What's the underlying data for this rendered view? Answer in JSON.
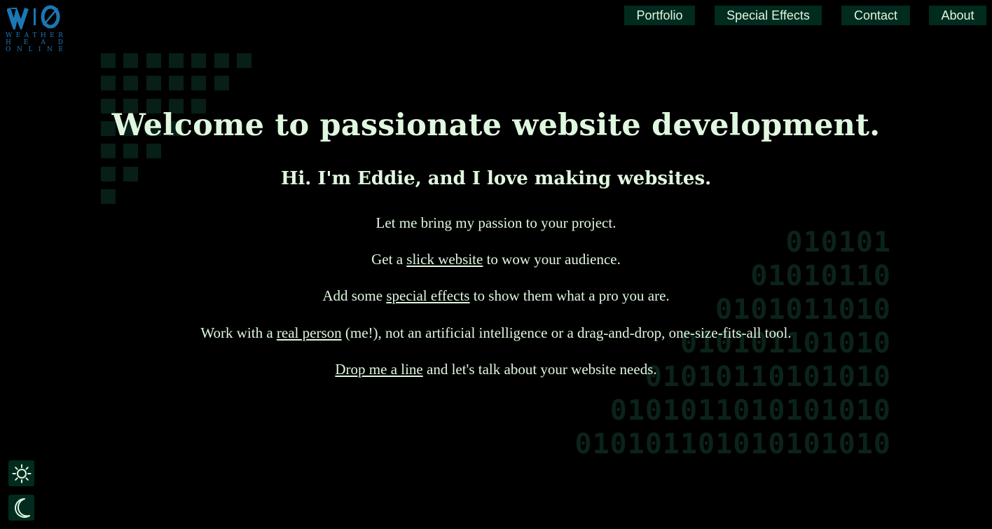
{
  "logo": {
    "mark": "WO",
    "lines": [
      "WEATHER",
      "HEAD",
      "ONLINE"
    ]
  },
  "nav": {
    "items": [
      "Portfolio",
      "Special Effects",
      "Contact",
      "About"
    ]
  },
  "background": {
    "binary_lines": [
      "010101",
      "01010110",
      "0101011010",
      "010101101010",
      "01010110101010",
      "0101011010101010",
      "010101101010101010"
    ]
  },
  "hero": {
    "title": "Welcome to passionate website development.",
    "subtitle": "Hi. I'm Eddie, and I love making websites."
  },
  "paragraphs": {
    "p1": "Let me bring my passion to your project.",
    "p2_before": "Get a ",
    "p2_link": "slick website",
    "p2_after": " to wow your audience.",
    "p3_before": "Add some ",
    "p3_link": "special effects",
    "p3_after": " to show them what a pro you are.",
    "p4_before": "Work with a ",
    "p4_link": "real person",
    "p4_after": " (me!), not an artificial intelligence or a drag-and-drop, one-size-fits-all tool.",
    "p5_link": "Drop me a line",
    "p5_after": " and let's talk about your website needs."
  },
  "theme_toggle": {
    "light_icon": "sun-icon",
    "dark_icon": "moon-icon"
  },
  "colors": {
    "background": "#000000",
    "text": "#dff7df",
    "nav_bg": "#012b1e",
    "logo": "#1b78b5",
    "decor": "#071f16"
  }
}
